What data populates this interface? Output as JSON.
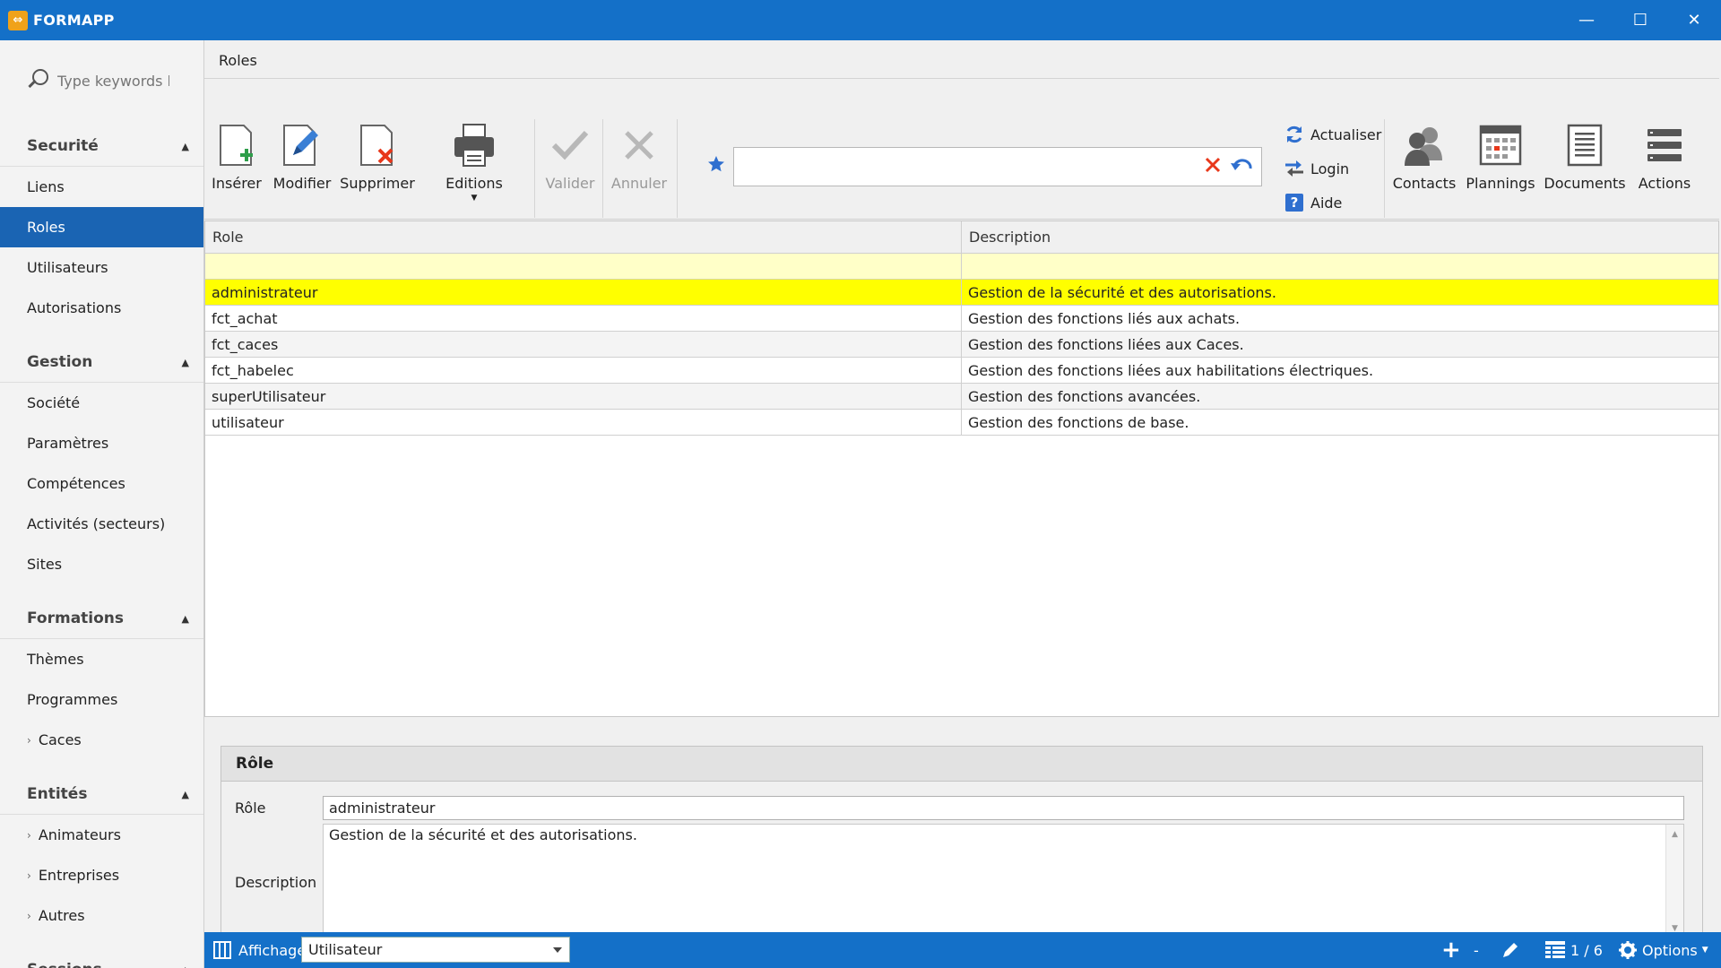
{
  "app": {
    "title": "FORMAPP",
    "logo_icon": "formapp-logo-icon"
  },
  "window_controls": {
    "minimize": "—",
    "maximize": "☐",
    "close": "✕"
  },
  "search": {
    "placeholder": "Type keywords he"
  },
  "sidebar": {
    "groups": [
      {
        "label": "Securité",
        "items": [
          {
            "label": "Liens"
          },
          {
            "label": "Roles",
            "active": true
          },
          {
            "label": "Utilisateurs"
          },
          {
            "label": "Autorisations"
          }
        ]
      },
      {
        "label": "Gestion",
        "items": [
          {
            "label": "Société"
          },
          {
            "label": "Paramètres"
          },
          {
            "label": "Compétences"
          },
          {
            "label": "Activités (secteurs)"
          },
          {
            "label": "Sites"
          }
        ]
      },
      {
        "label": "Formations",
        "items": [
          {
            "label": "Thèmes"
          },
          {
            "label": "Programmes"
          },
          {
            "label": "Caces",
            "expandable": true
          }
        ]
      },
      {
        "label": "Entités",
        "items": [
          {
            "label": "Animateurs",
            "expandable": true
          },
          {
            "label": "Entreprises",
            "expandable": true
          },
          {
            "label": "Autres",
            "expandable": true
          }
        ]
      },
      {
        "label": "Sessions",
        "items": []
      }
    ]
  },
  "breadcrumb": "Roles",
  "toolbar": {
    "insert": "Insérer",
    "edit": "Modifier",
    "delete": "Supprimer",
    "print": "Editions",
    "validate": "Valider",
    "cancel": "Annuler",
    "refresh": "Actualiser",
    "login": "Login",
    "help": "Aide",
    "contacts": "Contacts",
    "plannings": "Plannings",
    "documents": "Documents",
    "actions": "Actions"
  },
  "grid": {
    "columns": [
      "Role",
      "Description"
    ],
    "rows": [
      {
        "role": "administrateur",
        "description": "Gestion de la sécurité et des autorisations.",
        "selected": true
      },
      {
        "role": "fct_achat",
        "description": "Gestion des fonctions liés aux achats."
      },
      {
        "role": "fct_caces",
        "description": "Gestion des fonctions liées aux Caces."
      },
      {
        "role": "fct_habelec",
        "description": "Gestion des fonctions liées aux habilitations électriques."
      },
      {
        "role": "superUtilisateur",
        "description": "Gestion des fonctions avancées."
      },
      {
        "role": "utilisateur",
        "description": "Gestion des fonctions de base."
      }
    ]
  },
  "detail": {
    "title": "Rôle",
    "role_label": "Rôle",
    "role_value": "administrateur",
    "description_label": "Description",
    "description_value": "Gestion de la sécurité et des autorisations."
  },
  "statusbar": {
    "display_label": "Affichage",
    "display_value": "Utilisateur",
    "add_symbol": "+",
    "separator": "-",
    "pager": "1 / 6",
    "options": "Options"
  },
  "colors": {
    "accent": "#1470c8",
    "selected_nav": "#1a64b3",
    "selected_row": "#ffff00",
    "filter_row": "#ffffc8",
    "danger": "#e8381b"
  }
}
